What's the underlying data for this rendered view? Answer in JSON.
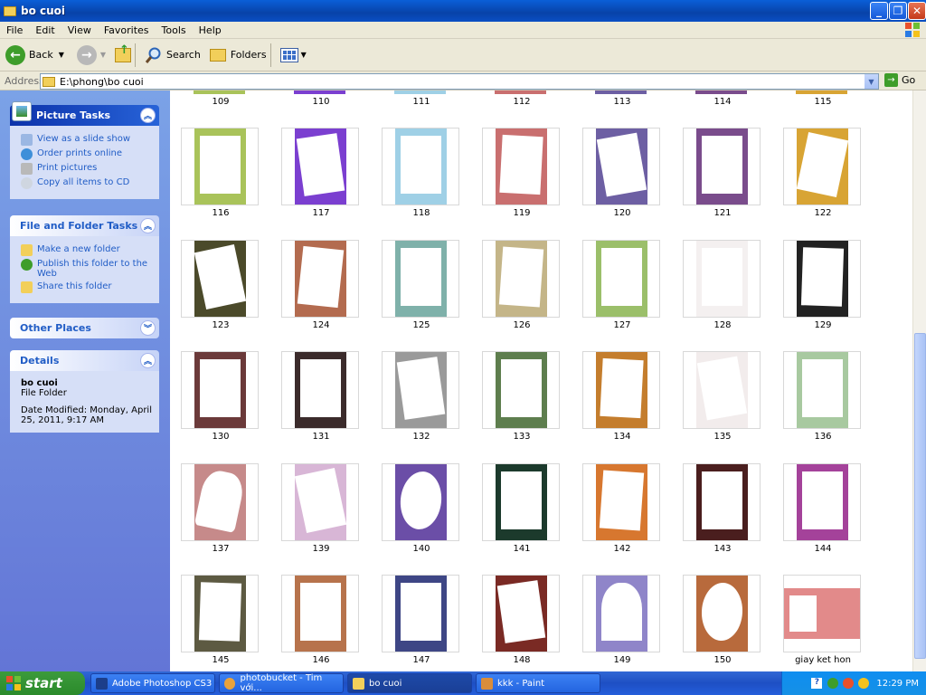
{
  "window": {
    "title": "bo cuoi"
  },
  "menu": [
    "File",
    "Edit",
    "View",
    "Favorites",
    "Tools",
    "Help"
  ],
  "toolbar": {
    "back": "Back",
    "search": "Search",
    "folders": "Folders"
  },
  "address": {
    "label": "Address",
    "value": "E:\\phong\\bo cuoi",
    "go": "Go"
  },
  "left_pane": {
    "picture_tasks": {
      "title": "Picture Tasks",
      "items": [
        "View as a slide show",
        "Order prints online",
        "Print pictures",
        "Copy all items to CD"
      ]
    },
    "file_folder_tasks": {
      "title": "File and Folder Tasks",
      "items": [
        "Make a new folder",
        "Publish this folder to the Web",
        "Share this folder"
      ]
    },
    "other_places": {
      "title": "Other Places"
    },
    "details": {
      "title": "Details",
      "name": "bo cuoi",
      "type": "File Folder",
      "modified": "Date Modified: Monday, April 25, 2011, 9:17 AM"
    }
  },
  "top_row_labels": [
    "109",
    "110",
    "111",
    "112",
    "113",
    "114",
    "115"
  ],
  "thumbnails": [
    [
      "116",
      "117",
      "118",
      "119",
      "120",
      "121",
      "122"
    ],
    [
      "123",
      "124",
      "125",
      "126",
      "127",
      "128",
      "129"
    ],
    [
      "130",
      "131",
      "132",
      "133",
      "134",
      "135",
      "136"
    ],
    [
      "137",
      "139",
      "140",
      "141",
      "142",
      "143",
      "144"
    ],
    [
      "145",
      "146",
      "147",
      "148",
      "149",
      "150",
      "giay ket hon"
    ]
  ],
  "thumb_colors": [
    [
      "#a9c35a",
      "#7b3fd0",
      "#9fd0e6",
      "#c96f6f",
      "#6d5fa3",
      "#7a4c8c",
      "#d8a434"
    ],
    [
      "#4b4a2a",
      "#b36b4f",
      "#7fb1aa",
      "#c4b588",
      "#9bbf6a",
      "#f4f0f0",
      "#222222"
    ],
    [
      "#6b3a3a",
      "#3b2b2b",
      "#9a9a9a",
      "#5e7e4e",
      "#c47d2d",
      "#f2ecec",
      "#a8c9a0"
    ],
    [
      "#c68a8a",
      "#d8b6d6",
      "#6b4ea7",
      "#1c3a2c",
      "#d7772f",
      "#4a1e1e",
      "#a4429a"
    ],
    [
      "#5d5a42",
      "#b7734c",
      "#3e4685",
      "#7a2a24",
      "#8f85c9",
      "#b86a3c",
      "#e28a8a"
    ]
  ],
  "taskbar": {
    "start": "start",
    "tasks": [
      "Adobe Photoshop CS3",
      "photobucket - Tim với...",
      "bo cuoi",
      "kkk - Paint"
    ],
    "clock": "12:29 PM"
  }
}
